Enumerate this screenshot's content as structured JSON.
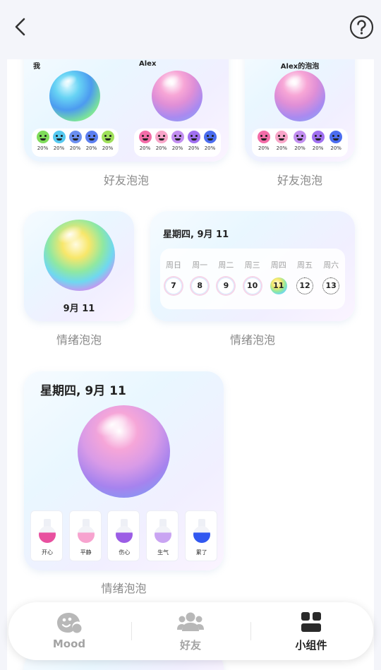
{
  "colors": {
    "page_bg": "#f4f5fa",
    "icon_gray": "#b8b8b8",
    "icon_dark": "#2a2a2a"
  },
  "header": {
    "back_icon": "chevron-left-icon",
    "help_icon": "question-circle-icon"
  },
  "widgets": {
    "friend_card_1": {
      "left_name": "我",
      "right_name": "Alex",
      "left_emojis": [
        {
          "mood": "开心",
          "color": "#7fdc5a",
          "pct": "20%"
        },
        {
          "mood": "难过",
          "color": "#56c9f0",
          "pct": "20%"
        },
        {
          "mood": "生气",
          "color": "#6b8ff0",
          "pct": "20%"
        },
        {
          "mood": "累了",
          "color": "#5c7ff0",
          "pct": "20%"
        },
        {
          "mood": "开心",
          "color": "#9fe05a",
          "pct": "20%"
        }
      ],
      "right_emojis": [
        {
          "mood": "开心",
          "color": "#f36da8",
          "pct": "20%"
        },
        {
          "mood": "平静",
          "color": "#f8a5c8",
          "pct": "20%"
        },
        {
          "mood": "生气",
          "color": "#c28ef0",
          "pct": "20%"
        },
        {
          "mood": "伤心",
          "color": "#a070f0",
          "pct": "20%"
        },
        {
          "mood": "累了",
          "color": "#4b6df0",
          "pct": "20%"
        }
      ],
      "caption": "好友泡泡"
    },
    "friend_card_2": {
      "name": "Alex的泡泡",
      "emojis": [
        {
          "mood": "开心",
          "color": "#f36da8",
          "pct": "20%"
        },
        {
          "mood": "平静",
          "color": "#f8a5c8",
          "pct": "20%"
        },
        {
          "mood": "生气",
          "color": "#c28ef0",
          "pct": "20%"
        },
        {
          "mood": "伤心",
          "color": "#a070f0",
          "pct": "20%"
        },
        {
          "mood": "累了",
          "color": "#4b6df0",
          "pct": "20%"
        }
      ],
      "caption": "好友泡泡"
    },
    "small_mood": {
      "date": "9月 11",
      "caption": "情绪泡泡"
    },
    "week_card": {
      "title": "星期四, 9月 11",
      "days": [
        {
          "name": "周日",
          "num": "7",
          "style": "ring"
        },
        {
          "name": "周一",
          "num": "8",
          "style": "ring"
        },
        {
          "name": "周二",
          "num": "9",
          "style": "ring"
        },
        {
          "name": "周三",
          "num": "10",
          "style": "ring"
        },
        {
          "name": "周四",
          "num": "11",
          "style": "filled"
        },
        {
          "name": "周五",
          "num": "12",
          "style": "dotted"
        },
        {
          "name": "周六",
          "num": "13",
          "style": "dotted"
        }
      ],
      "caption": "情绪泡泡"
    },
    "large_mood": {
      "title": "星期四, 9月 11",
      "flasks": [
        {
          "label": "开心",
          "color": "#e8509f"
        },
        {
          "label": "平静",
          "color": "#f7a3cf"
        },
        {
          "label": "伤心",
          "color": "#9b5de5"
        },
        {
          "label": "生气",
          "color": "#c9a4f2"
        },
        {
          "label": "累了",
          "color": "#3158f0"
        }
      ],
      "caption": "情绪泡泡"
    }
  },
  "tabbar": {
    "tabs": [
      {
        "label": "Mood",
        "icon": "mood-face-icon",
        "active": false
      },
      {
        "label": "好友",
        "icon": "friends-icon",
        "active": false
      },
      {
        "label": "小组件",
        "icon": "widgets-icon",
        "active": true
      }
    ]
  }
}
